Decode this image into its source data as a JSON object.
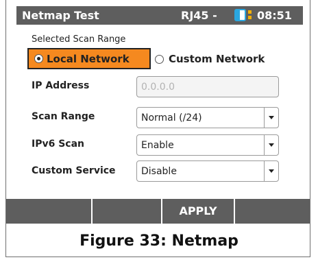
{
  "titlebar": {
    "app": "Netmap",
    "test": "Test",
    "port": "RJ45 -",
    "time": "08:51",
    "battery_icon": "battery-icon",
    "accent": "#2aa7e0"
  },
  "scan_range_heading": "Selected Scan Range",
  "radios": {
    "local": {
      "label": "Local Network",
      "selected": true
    },
    "custom": {
      "label": "Custom Network",
      "selected": false
    }
  },
  "fields": {
    "ip_address": {
      "label": "IP Address",
      "placeholder": "0.0.0.0"
    },
    "scan_range": {
      "label": "Scan Range",
      "value": "Normal (/24)"
    },
    "ipv6_scan": {
      "label": "IPv6 Scan",
      "value": "Enable"
    },
    "custom_service": {
      "label": "Custom Service",
      "value": "Disable"
    }
  },
  "softkeys": [
    "",
    "",
    "APPLY",
    ""
  ],
  "caption": "Figure 33: Netmap",
  "colors": {
    "titlebar": "#5e5e5e",
    "selected": "#f5891f"
  }
}
